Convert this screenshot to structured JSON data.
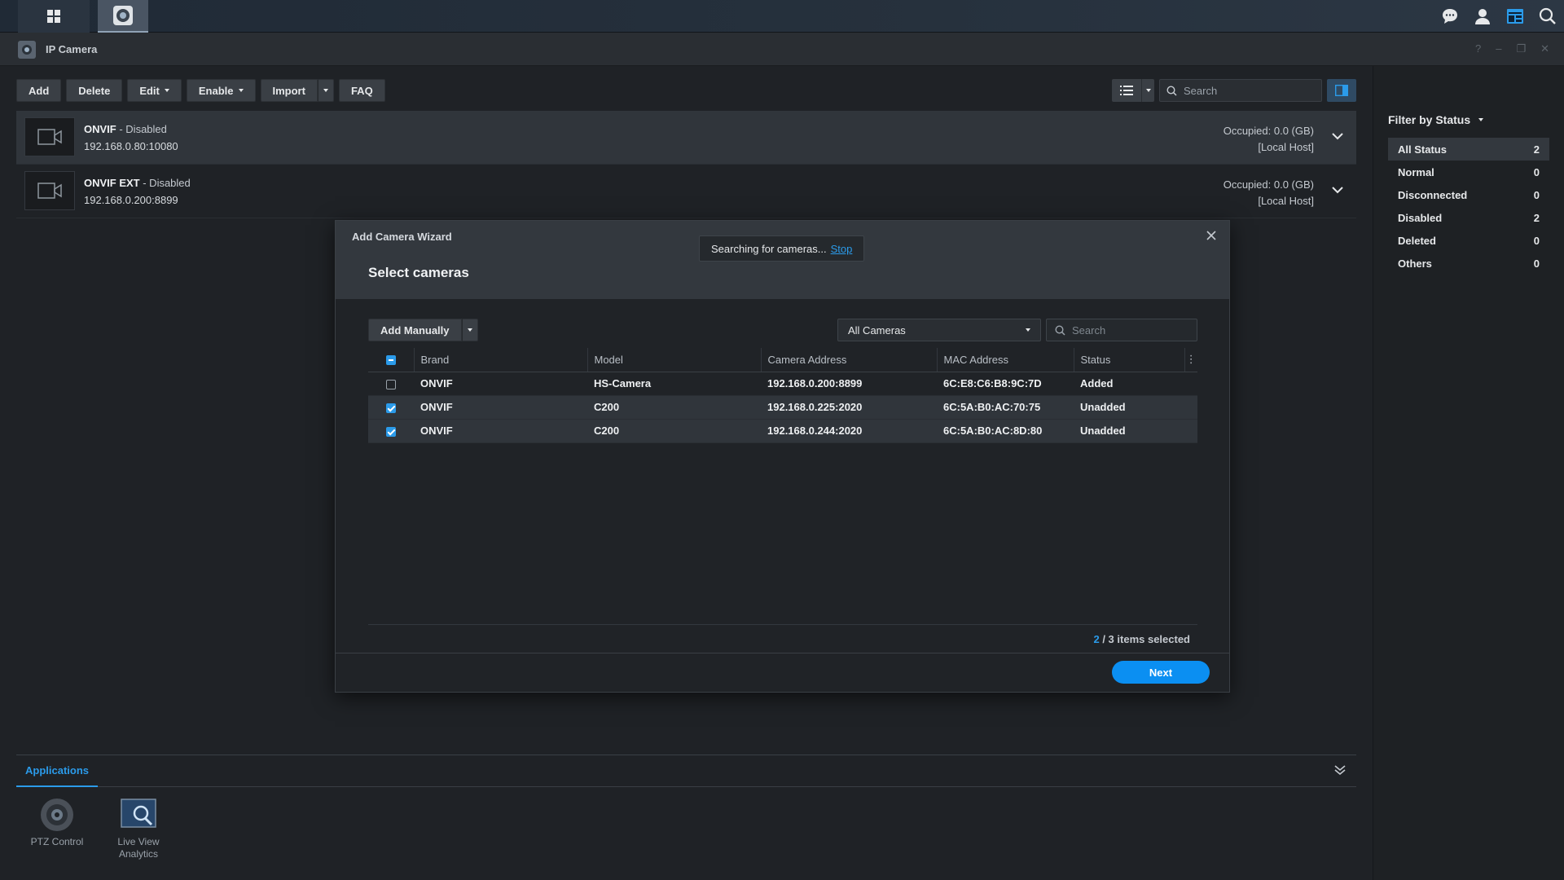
{
  "window": {
    "title": "IP Camera"
  },
  "toolbar": {
    "add": "Add",
    "delete": "Delete",
    "edit": "Edit",
    "enable": "Enable",
    "import": "Import",
    "faq": "FAQ",
    "search_placeholder": "Search"
  },
  "cameras": [
    {
      "name": "ONVIF",
      "status": " - Disabled",
      "address": "192.168.0.80:10080",
      "occupied": "Occupied: 0.0 (GB)",
      "host": "[Local Host]"
    },
    {
      "name": "ONVIF EXT",
      "status": " - Disabled",
      "address": "192.168.0.200:8899",
      "occupied": "Occupied: 0.0 (GB)",
      "host": "[Local Host]"
    }
  ],
  "filter": {
    "title": "Filter by Status",
    "items": [
      {
        "label": "All Status",
        "count": "2"
      },
      {
        "label": "Normal",
        "count": "0"
      },
      {
        "label": "Disconnected",
        "count": "0"
      },
      {
        "label": "Disabled",
        "count": "2"
      },
      {
        "label": "Deleted",
        "count": "0"
      },
      {
        "label": "Others",
        "count": "0"
      }
    ]
  },
  "applications": {
    "tab": "Applications",
    "apps": [
      {
        "label": "PTZ Control"
      },
      {
        "label": "Live View Analytics"
      }
    ]
  },
  "dialog": {
    "title": "Add Camera Wizard",
    "subtitle": "Select cameras",
    "searching_text": "Searching for cameras...",
    "stop": "Stop",
    "add_manually": "Add Manually",
    "filter_value": "All Cameras",
    "search_placeholder": "Search",
    "columns": [
      "Brand",
      "Model",
      "Camera Address",
      "MAC Address",
      "Status"
    ],
    "rows": [
      {
        "brand": "ONVIF",
        "model": "HS-Camera",
        "address": "192.168.0.200:8899",
        "mac": "6C:E8:C6:B8:9C:7D",
        "status": "Added",
        "checked": false
      },
      {
        "brand": "ONVIF",
        "model": "C200",
        "address": "192.168.0.225:2020",
        "mac": "6C:5A:B0:AC:70:75",
        "status": "Unadded",
        "checked": true
      },
      {
        "brand": "ONVIF",
        "model": "C200",
        "address": "192.168.0.244:2020",
        "mac": "6C:5A:B0:AC:8D:80",
        "status": "Unadded",
        "checked": true
      }
    ],
    "selected_count": "2",
    "selected_suffix": " / 3 items selected",
    "next": "Next"
  },
  "colors": {
    "accent": "#2b9bea",
    "primary_button": "#0b8ff2"
  }
}
